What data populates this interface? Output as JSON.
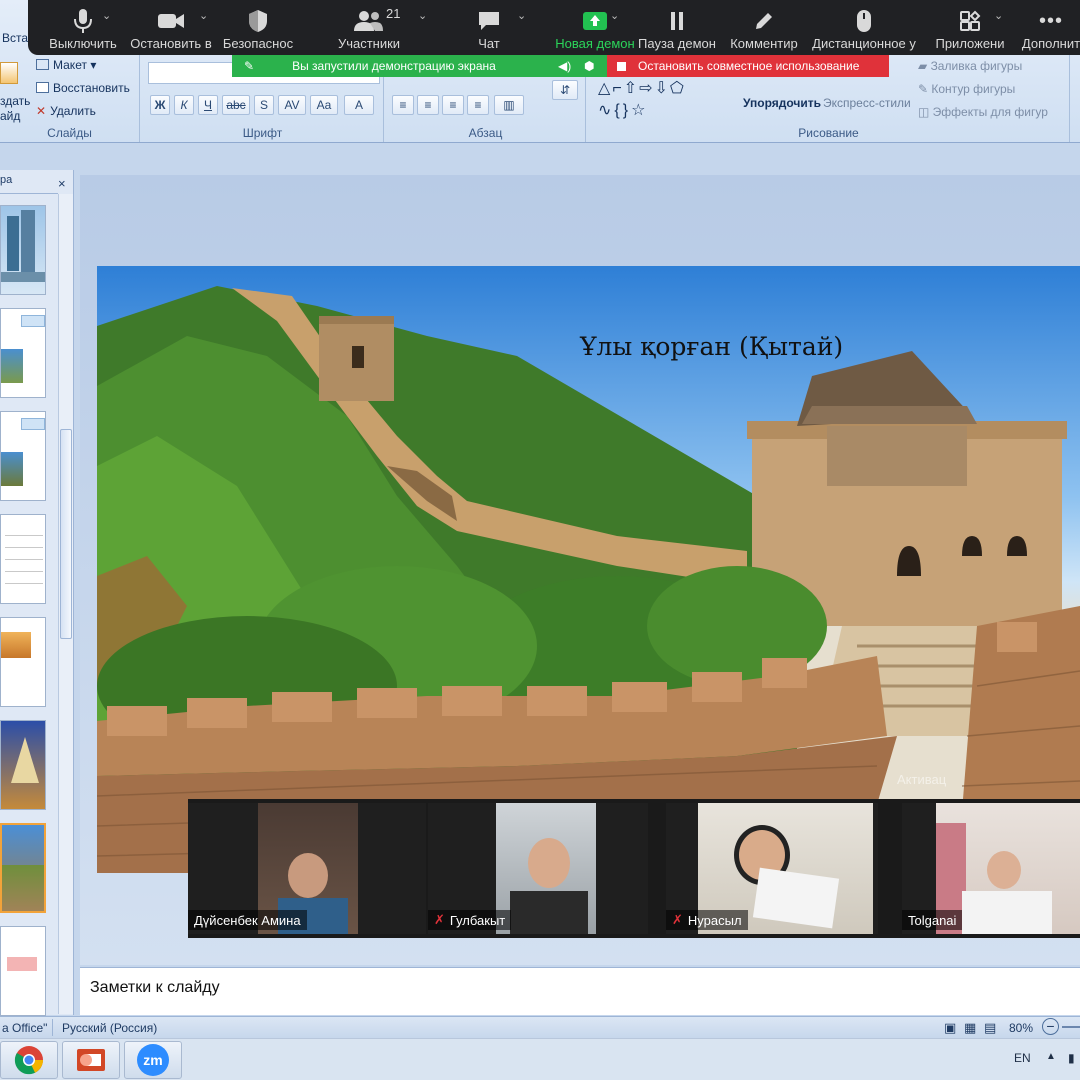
{
  "zoom_toolbar": {
    "buttons": [
      {
        "label": "Выключить",
        "icon": "microphone-icon"
      },
      {
        "label": "Остановить в",
        "icon": "video-camera-icon"
      },
      {
        "label": "Безопаснос",
        "icon": "shield-icon"
      },
      {
        "label": "Участники",
        "icon": "participants-icon",
        "count": "21"
      },
      {
        "label": "Чат",
        "icon": "chat-icon"
      },
      {
        "label": "Новая демон",
        "icon": "share-screen-icon"
      },
      {
        "label": "Пауза демон",
        "icon": "pause-icon"
      },
      {
        "label": "Комментир",
        "icon": "pencil-icon"
      },
      {
        "label": "Дистанционное у",
        "icon": "mouse-icon"
      },
      {
        "label": "Приложени",
        "icon": "apps-icon"
      },
      {
        "label": "Дополнит",
        "icon": "more-icon"
      }
    ],
    "share_banner": "Вы запустили демонстрацию экрана",
    "stop_share": "Остановить совместное использование",
    "colors": {
      "share_green": "#2bb24c",
      "stop_red": "#e0323a",
      "bar": "#202124"
    }
  },
  "ribbon": {
    "partial_tab": "Встав",
    "slides_group": {
      "title": "Слайды",
      "create_partial": "здать",
      "slide_partial": "айд",
      "layout": "Макет",
      "reset": "Восстановить",
      "delete": "Удалить"
    },
    "font_group": {
      "title": "Шрифт",
      "bold": "Ж",
      "italic": "К",
      "underline": "Ч",
      "strike": "abc",
      "shadow": "S",
      "spacing": "AV",
      "case": "Aa",
      "color": "A"
    },
    "paragraph_group": {
      "title": "Абзац"
    },
    "drawing_group": {
      "title": "Рисование",
      "arrange": "Упорядочить",
      "express_styles": "Экспресс-стили",
      "fill": "Заливка фигуры",
      "outline": "Контур фигуры",
      "effects": "Эффекты для фигур"
    }
  },
  "thumbnail_pane": {
    "tab_partial": "ра",
    "close": "×"
  },
  "slide": {
    "title": "Ұлы қорған (Қытай)",
    "watermark": "Активац"
  },
  "participants": [
    {
      "name": "Дүйсенбек Амина",
      "muted": false
    },
    {
      "name": "Гулбакыт",
      "muted": true
    },
    {
      "name": "Нурасыл",
      "muted": true
    },
    {
      "name": "Tolganai",
      "muted": false
    }
  ],
  "notes": {
    "placeholder": "Заметки к слайду"
  },
  "status_bar": {
    "theme_partial": "а Office\"",
    "language": "Русский (Россия)",
    "zoom": "80%"
  },
  "taskbar": {
    "apps": [
      {
        "icon": "chrome-icon"
      },
      {
        "icon": "powerpoint-icon"
      },
      {
        "icon": "zoom-icon",
        "label": "zm"
      }
    ],
    "lang": "EN"
  }
}
